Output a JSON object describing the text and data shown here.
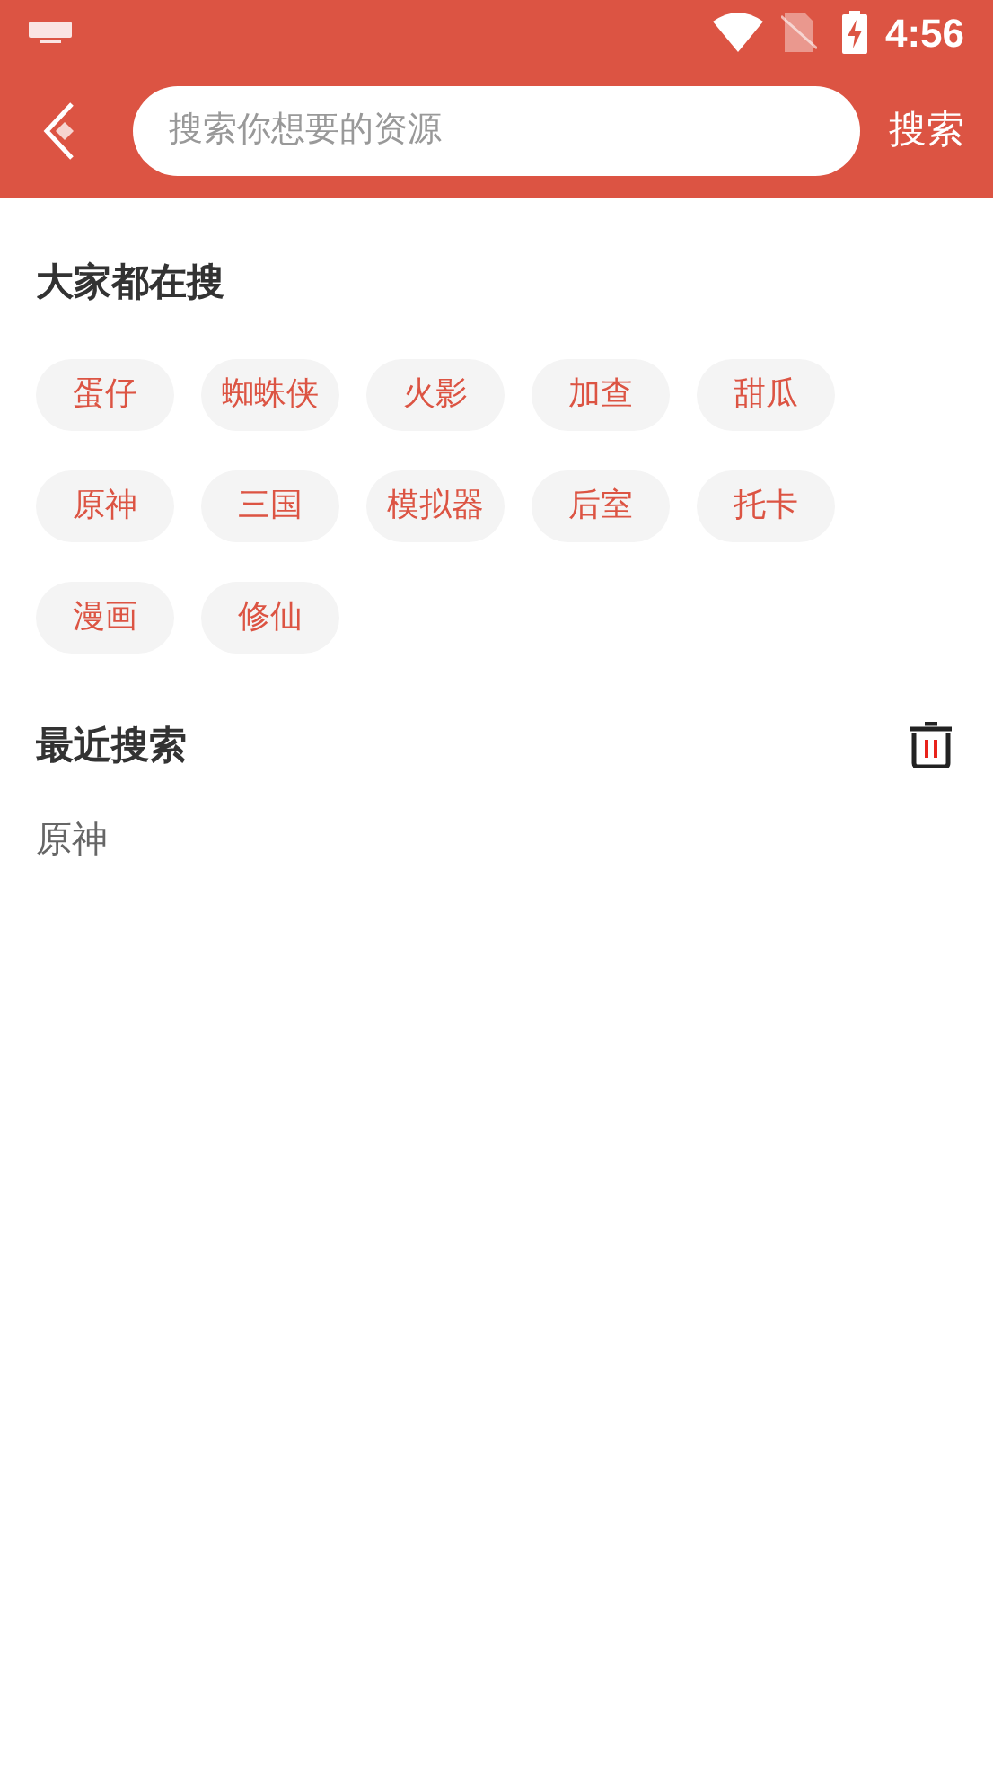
{
  "status_bar": {
    "time": "4:56"
  },
  "search_bar": {
    "placeholder": "搜索你想要的资源",
    "button": "搜索"
  },
  "hot_searches": {
    "title": "大家都在搜",
    "tags": [
      "蛋仔",
      "蜘蛛侠",
      "火影",
      "加查",
      "甜瓜",
      "原神",
      "三国",
      "模拟器",
      "后室",
      "托卡",
      "漫画",
      "修仙"
    ]
  },
  "recent_searches": {
    "title": "最近搜索",
    "items": [
      "原神"
    ]
  }
}
